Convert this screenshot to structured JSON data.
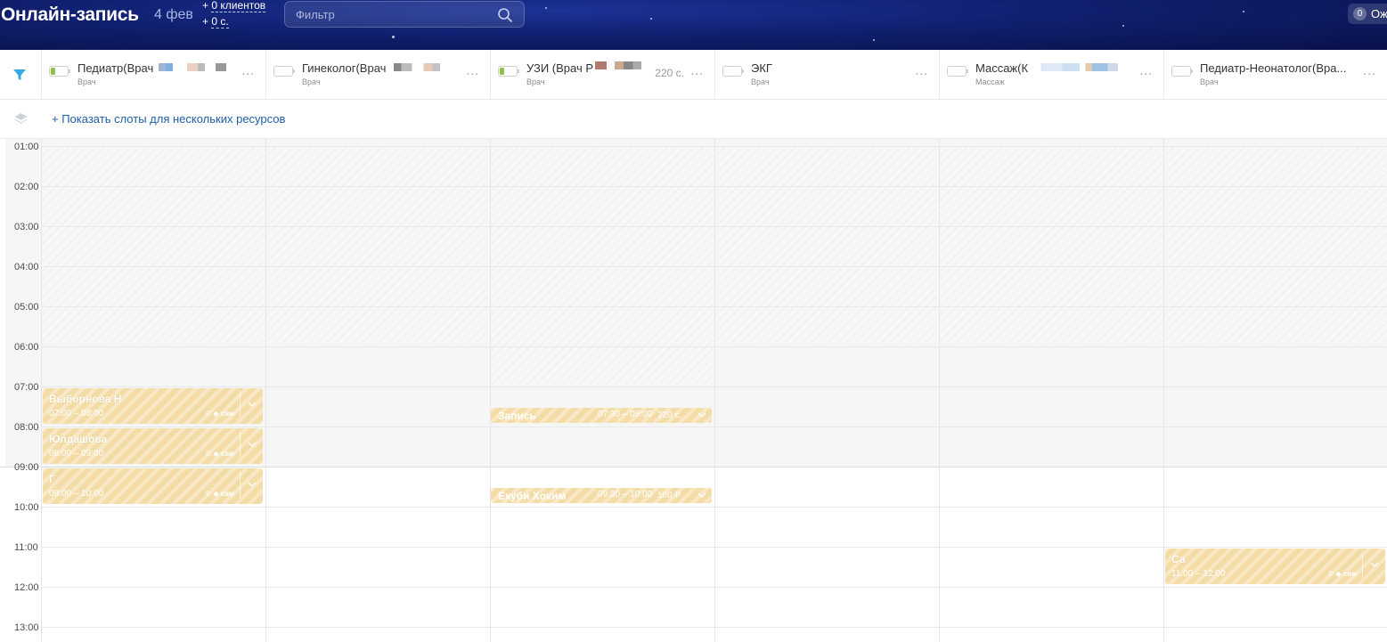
{
  "app": {
    "title": "Онлайн-запись",
    "date": "4 фев",
    "clients_stat_prefix": "+",
    "clients_stat_value": "0 клиентов",
    "sum_stat_prefix": "+",
    "sum_stat_value": "0 с.",
    "filter_placeholder": "Фильтр",
    "waiting_count": "0",
    "waiting_label": "Ож"
  },
  "colors": {
    "accent": "#1f5ea6",
    "appointment": "#f4dca6",
    "battery_green": "#8cc34a",
    "topbar": "#101f6e"
  },
  "resources": [
    {
      "name": "Педиатр(Врач",
      "role": "Врач",
      "battery": 0.25,
      "cost": ""
    },
    {
      "name": "Гинеколог(Врач",
      "role": "Врач",
      "battery": 0,
      "cost": ""
    },
    {
      "name": "УЗИ (Врач Р",
      "role": "Врач",
      "battery": 0.25,
      "cost": "220 с."
    },
    {
      "name": "ЭКГ",
      "role": "Врач",
      "battery": 0,
      "cost": ""
    },
    {
      "name": "Массаж(К",
      "role": "Массаж",
      "battery": 0,
      "cost": ""
    },
    {
      "name": "Педиатр-Неонатолог(Вра...",
      "role": "Врач",
      "battery": 0,
      "cost": ""
    }
  ],
  "more_label": "...",
  "slots_link": "+ Показать слоты для нескольких ресурсов",
  "hours": [
    "01:00",
    "02:00",
    "03:00",
    "04:00",
    "05:00",
    "06:00",
    "07:00",
    "08:00",
    "09:00",
    "10:00",
    "11:00",
    "12:00",
    "13:00"
  ],
  "appointments": [
    {
      "name": "Выборнова Н",
      "time": "07:00 – 08:00",
      "label": "свм"
    },
    {
      "name": "Юлдашова",
      "time": "08:00 – 09:00",
      "label": "свм"
    },
    {
      "name": "Г",
      "time": "09:00 – 10:00",
      "label": "свм"
    },
    {
      "name": "Са",
      "time": "11:00 – 12:00",
      "label": "свм"
    }
  ],
  "mini_appointments": [
    {
      "name": "Запись",
      "time": "07:30 – 08:00",
      "cost": "220 с."
    },
    {
      "name": "Екуби Хоким",
      "time": "09:30 – 10:00",
      "cost": "100 ₽"
    }
  ]
}
